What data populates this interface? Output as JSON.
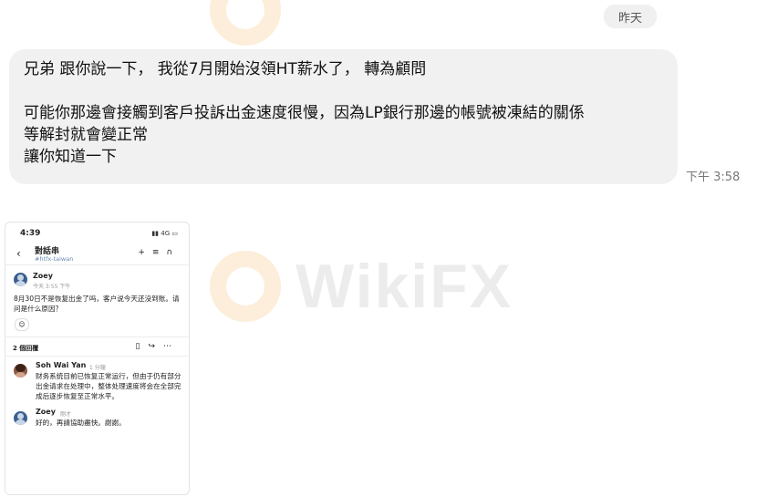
{
  "chat": {
    "date_label": "昨天",
    "message": {
      "line1": "兄弟 跟你說一下， 我從7月開始沒領HT薪水了， 轉為顧問",
      "line2": "可能你那邊會接觸到客戶投訴出金速度很慢，因為LP銀行那邊的帳號被凍結的關係",
      "line3": "等解封就會變正常",
      "line4": "讓你知道一下",
      "time": "下午 3:58"
    }
  },
  "watermark": {
    "text": "WikiFX"
  },
  "phone": {
    "status_time": "4:39",
    "status_right": "4G",
    "back_icon": "chevron-left-icon",
    "title": "對話串",
    "channel": "#htfx-taiwan",
    "header_icons": [
      "add-icon",
      "headphones-icon"
    ],
    "thread": {
      "author": "Zoey",
      "meta": "今天 3:55 下午",
      "text": "8月30日不是恢复出金了吗，客户说今天还没到账。请问是什么原因？",
      "reaction_icon": "add-reaction-icon"
    },
    "replies_label": "2 個回覆",
    "action_icons": [
      "bookmark-icon",
      "share-icon",
      "more-icon"
    ],
    "replies": [
      {
        "author": "Soh Wai Yan",
        "meta": "1 分鐘",
        "text": "财务系统目前已恢复正常运行，但由于仍有部分出金请求在处理中，整体处理速度将会在全部完成后逐步恢复至正常水平。"
      },
      {
        "author": "Zoey",
        "meta": "剛才",
        "text": "好的，再請協助盡快。謝謝。"
      }
    ]
  }
}
